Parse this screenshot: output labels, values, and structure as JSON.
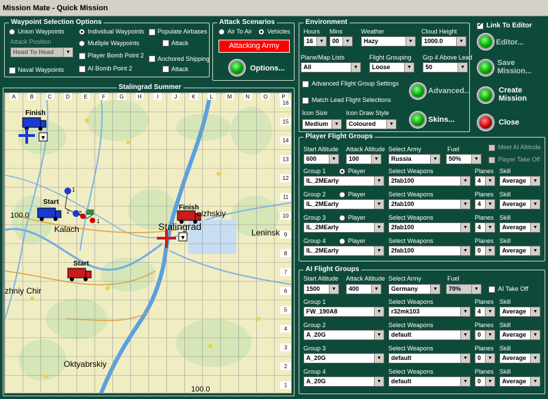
{
  "window": {
    "title": "Mission Mate - Quick Mission"
  },
  "waypoint": {
    "legend": "Waypoint Selection Options",
    "union": "Union Waypoints",
    "individual": "Individual Waypoints",
    "multiple": "Mutliple Waypoints",
    "attack_position_label": "Attack Position",
    "attack_position_value": "Head To Head",
    "player_bomb": "Player Bomb Point 2",
    "ai_bomb": "AI Bomb Point 2",
    "naval": "Naval Waypoints",
    "populate_airbases": "Populate Airbases",
    "attack1": "Attack",
    "anchored_shipping": "Anchored Shipping",
    "attack2": "Attack"
  },
  "attack": {
    "legend": "Attack Scenarios",
    "air_to_air": "Air To Air",
    "vehicles": "Vehicles",
    "army_button": "Attacking Army",
    "options": "Options..."
  },
  "environment": {
    "legend": "Environment",
    "hours_label": "Hours",
    "hours": "16",
    "mins_label": "Mins",
    "mins": "00",
    "weather_label": "Weather",
    "weather": "Hazy",
    "cloud_label": "Cloud Height",
    "cloud": "1000.0",
    "plane_lists_label": "Plane/Map Lists",
    "plane_lists": "All",
    "flight_grouping_label": "Flight Grouping",
    "flight_grouping": "Loose",
    "grp4_label": "Grp 4 Above Lead",
    "grp4": "50",
    "advanced_settings": "Advanced Flight Group Settings",
    "match_lead": "Match Lead Flight Selections",
    "icon_size_label": "Icon Size",
    "icon_size": "Medium",
    "icon_style_label": "Icon Draw Style",
    "icon_style": "Coloured",
    "advanced_btn": "Advanced...",
    "skins_btn": "Skins..."
  },
  "side": {
    "link_editor": "Link To Editor",
    "editor": "Editor...",
    "save": "Save Mission...",
    "create": "Create Mission",
    "close": "Close"
  },
  "player": {
    "legend": "Player Flight Groups",
    "start_alt_label": "Start Altitude",
    "start_alt": "600",
    "attack_alt_label": "Attack Altitude",
    "attack_alt": "100",
    "army_label": "Select Army",
    "army": "Russia",
    "fuel_label": "Fuel",
    "fuel": "50%",
    "meet_ai": "Meet AI Altitude",
    "player_takeoff": "Player Take Off",
    "player_radio": "Player",
    "weapons_label": "Select Weapons",
    "planes_label": "Planes",
    "skill_label": "Skill",
    "groups": [
      {
        "label": "Group 1",
        "plane": "IL_2MEarly",
        "weapons": "2fab100",
        "planes": "4",
        "skill": "Average"
      },
      {
        "label": "Group 2",
        "plane": "IL_2MEarly",
        "weapons": "2fab100",
        "planes": "4",
        "skill": "Average"
      },
      {
        "label": "Group 3",
        "plane": "IL_2MEarly",
        "weapons": "2fab100",
        "planes": "4",
        "skill": "Average"
      },
      {
        "label": "Group 4",
        "plane": "IL_2MEarly",
        "weapons": "2fab100",
        "planes": "0",
        "skill": "Average"
      }
    ]
  },
  "ai": {
    "legend": "AI Flight Groups",
    "start_alt_label": "Start Altitude",
    "start_alt": "1500",
    "attack_alt_label": "Attack Altitude",
    "attack_alt": "400",
    "army_label": "Select Army",
    "army": "Germany",
    "fuel_label": "Fuel",
    "fuel": "70%",
    "ai_takeoff": "AI Take Off",
    "weapons_label": "Select Weapons",
    "planes_label": "Planes",
    "skill_label": "Skill",
    "groups": [
      {
        "label": "Group 1",
        "plane": "FW_190A8",
        "weapons": "r32mk103",
        "planes": "4",
        "skill": "Average"
      },
      {
        "label": "Group 2",
        "plane": "A_20G",
        "weapons": "default",
        "planes": "0",
        "skill": "Average"
      },
      {
        "label": "Group 3",
        "plane": "A_20G",
        "weapons": "default",
        "planes": "0",
        "skill": "Average"
      },
      {
        "label": "Group 4",
        "plane": "A_20G",
        "weapons": "default",
        "planes": "0",
        "skill": "Average"
      }
    ]
  },
  "map": {
    "title": "Stalingrad Summer",
    "columns": [
      "A",
      "B",
      "C",
      "D",
      "E",
      "F",
      "G",
      "H",
      "I",
      "J",
      "K",
      "L",
      "M",
      "N",
      "O",
      "P"
    ],
    "rows": [
      "16",
      "15",
      "14",
      "13",
      "12",
      "11",
      "10",
      "9",
      "8",
      "7",
      "6",
      "5",
      "4",
      "3",
      "2",
      "1"
    ],
    "towns": {
      "kalach": "Kalach",
      "stalingrad": "Stalingrad",
      "leninsk": "Leninsk",
      "chir": "zhniy Chir",
      "oktyabrskiy": "Oktyabrskiy",
      "oizhskiy": "oizhskiy"
    },
    "markers": {
      "finish": "Finish",
      "start": "Start",
      "grid_100a": "100.0",
      "grid_100b": "100.0"
    },
    "waypoint_numbers": [
      "1",
      "2",
      "0",
      "1",
      "2"
    ]
  }
}
